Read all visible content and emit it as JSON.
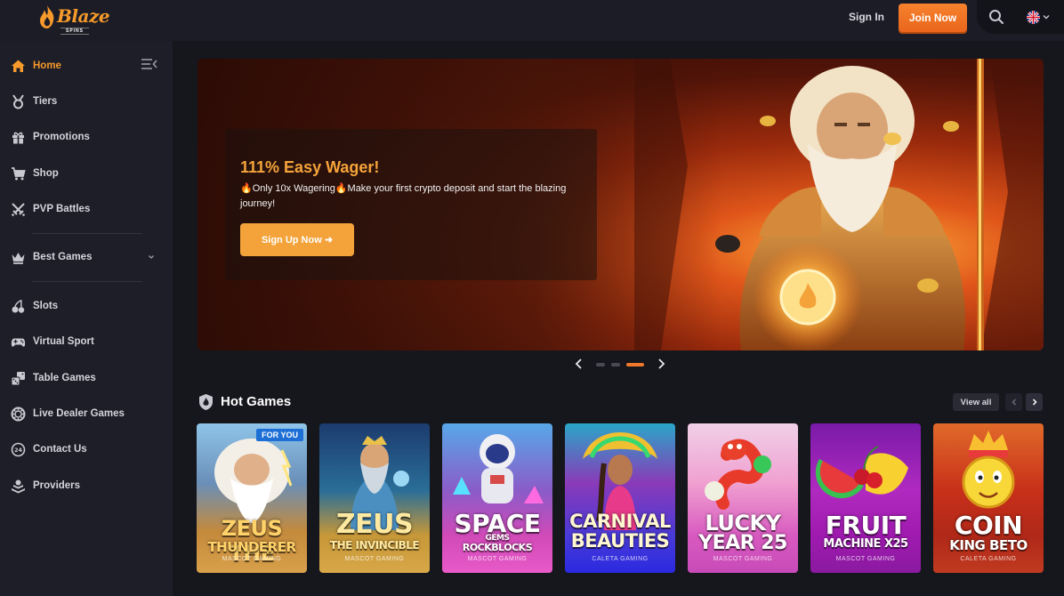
{
  "header": {
    "logo_text": "Blaze",
    "logo_sub": "SPINS",
    "signin_label": "Sign In",
    "join_label": "Join Now",
    "accent": "#f59a2b"
  },
  "sidebar": {
    "items": [
      {
        "label": "Home",
        "icon": "home-icon"
      },
      {
        "label": "Tiers",
        "icon": "medal-icon"
      },
      {
        "label": "Promotions",
        "icon": "gift-icon"
      },
      {
        "label": "Shop",
        "icon": "cart-icon"
      },
      {
        "label": "PVP Battles",
        "icon": "swords-icon"
      },
      {
        "label": "Best Games",
        "icon": "crown-icon"
      },
      {
        "label": "Slots",
        "icon": "cherries-icon"
      },
      {
        "label": "Virtual Sport",
        "icon": "gamepad-icon"
      },
      {
        "label": "Table Games",
        "icon": "dice-icon"
      },
      {
        "label": "Live Dealer Games",
        "icon": "chip-icon"
      },
      {
        "label": "Contact Us",
        "icon": "support-24-icon"
      },
      {
        "label": "Providers",
        "icon": "providers-icon"
      }
    ]
  },
  "banner": {
    "title": "111% Easy Wager!",
    "text": "🔥Only 10x Wagering🔥Make your first crypto deposit and start the blazing journey!",
    "button_label": "Sign Up Now ➜",
    "slides_total": 3,
    "active_slide": 3
  },
  "hot_games": {
    "title": "Hot Games",
    "view_all_label": "View all",
    "games": [
      {
        "line1": "ZEUS THE",
        "line2": "THUNDERER",
        "provider": "MASCOT GAMING",
        "badge": "FOR YOU"
      },
      {
        "line1": "ZEUS",
        "line2": "THE INVINCIBLE",
        "provider": "MASCOT GAMING"
      },
      {
        "line1": "SPACE",
        "line2": "GEMS",
        "line3": "ROCKBLOCKS",
        "provider": "MASCOT GAMING"
      },
      {
        "line1": "CARNIVAL",
        "line2": "BEAUTIES",
        "provider": "CALETA GAMING"
      },
      {
        "line1": "LUCKY",
        "line2": "YEAR 25",
        "provider": "MASCOT GAMING"
      },
      {
        "line1": "FRUIT",
        "line2": "MACHINE X25",
        "provider": "MASCOT GAMING"
      },
      {
        "line1": "COIN",
        "line2": "KING BETO",
        "provider": "CALETA GAMING"
      }
    ]
  }
}
